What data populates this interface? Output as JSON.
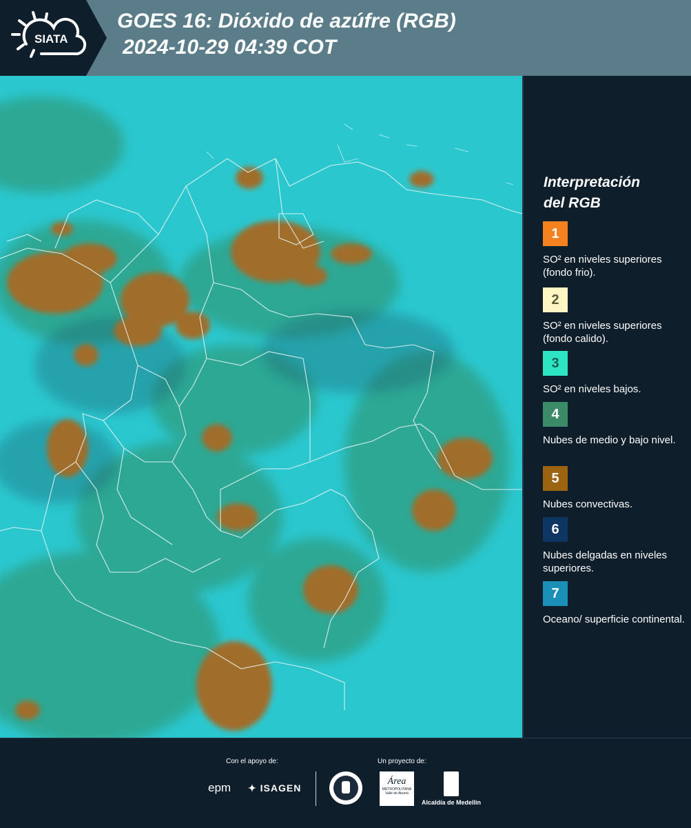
{
  "header": {
    "brand": "SIATA",
    "title_line1": "GOES 16: Dióxido de azúfre (RGB)",
    "title_line2": "2024-10-29 04:39 COT"
  },
  "legend": {
    "title_line1": "Interpretación",
    "title_line2": "del RGB",
    "items": [
      {
        "number": "1",
        "color": "#f5821f",
        "numcolor": "#ffffff",
        "text": "SO² en niveles superiores (fondo frio)."
      },
      {
        "number": "2",
        "color": "#fff6c4",
        "numcolor": "#5a5a3a",
        "text": "SO² en niveles superiores (fondo calido)."
      },
      {
        "number": "3",
        "color": "#2de5c3",
        "numcolor": "#1c5f56",
        "text": "SO² en niveles bajos."
      },
      {
        "number": "4",
        "color": "#3b8a68",
        "numcolor": "#ffffff",
        "text": "Nubes de medio y bajo nivel."
      },
      {
        "number": "5",
        "color": "#9c6310",
        "numcolor": "#ffffff",
        "text": "Nubes convectivas."
      },
      {
        "number": "6",
        "color": "#0e3663",
        "numcolor": "#ffffff",
        "text": "Nubes delgadas en niveles superiores."
      },
      {
        "number": "7",
        "color": "#1a8fb8",
        "numcolor": "#ffffff",
        "text": "Oceano/ superficie continental."
      }
    ]
  },
  "footer": {
    "support_label": "Con el apoyo de:",
    "project_label": "Un proyecto de:",
    "sponsor1": "epm",
    "sponsor2": "ISAGEN",
    "partner1_line1": "Área",
    "partner1_line2": "METROPOLITANA",
    "partner1_line3": "Valle de Aburrá",
    "partner2": "Alcaldía de Medellín"
  },
  "colors": {
    "background": "#0e1e2b",
    "header": "#5b7d8a",
    "map_base": "#29c5cc",
    "convective": "#9c6a28",
    "midlevel": "#2f8a5a"
  }
}
